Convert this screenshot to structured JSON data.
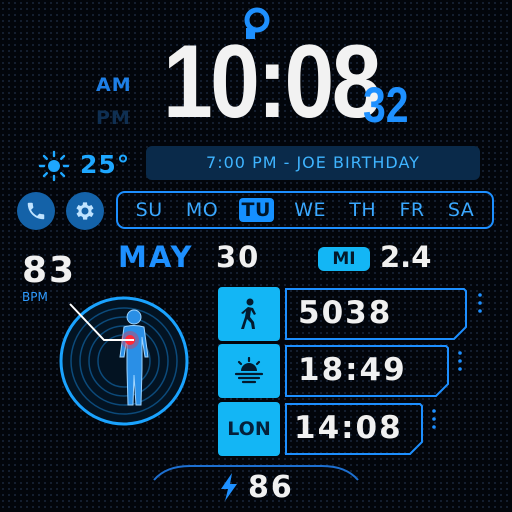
{
  "time": {
    "hours_minutes": "10:08",
    "seconds": "32",
    "am_label": "AM",
    "pm_label": "PM"
  },
  "weather": {
    "icon": "sun-icon",
    "temperature": "25°"
  },
  "event": {
    "text": "7:00 PM - JOE BIRTHDAY"
  },
  "shortcuts": [
    {
      "icon": "phone-icon"
    },
    {
      "icon": "gear-icon"
    }
  ],
  "weekdays": {
    "days": [
      "SU",
      "MO",
      "TU",
      "WE",
      "TH",
      "FR",
      "SA"
    ],
    "active": "TU"
  },
  "date": {
    "month": "MAY",
    "day": "30"
  },
  "distance": {
    "unit": "MI",
    "value": "2.4"
  },
  "heart_rate": {
    "value": "83",
    "unit": "BPM"
  },
  "complications": [
    {
      "icon": "walk-icon",
      "value": "5038"
    },
    {
      "icon": "sunset-icon",
      "value": "18:49"
    },
    {
      "label": "LON",
      "value": "14:08"
    }
  ],
  "battery": {
    "icon": "lightning-icon",
    "value": "86"
  },
  "colors": {
    "accent": "#1e90ff",
    "cyan": "#13b6f5",
    "dark_blue": "#0a2a4a",
    "text": "#f0f0f0",
    "heart": "#ff2a3a"
  }
}
